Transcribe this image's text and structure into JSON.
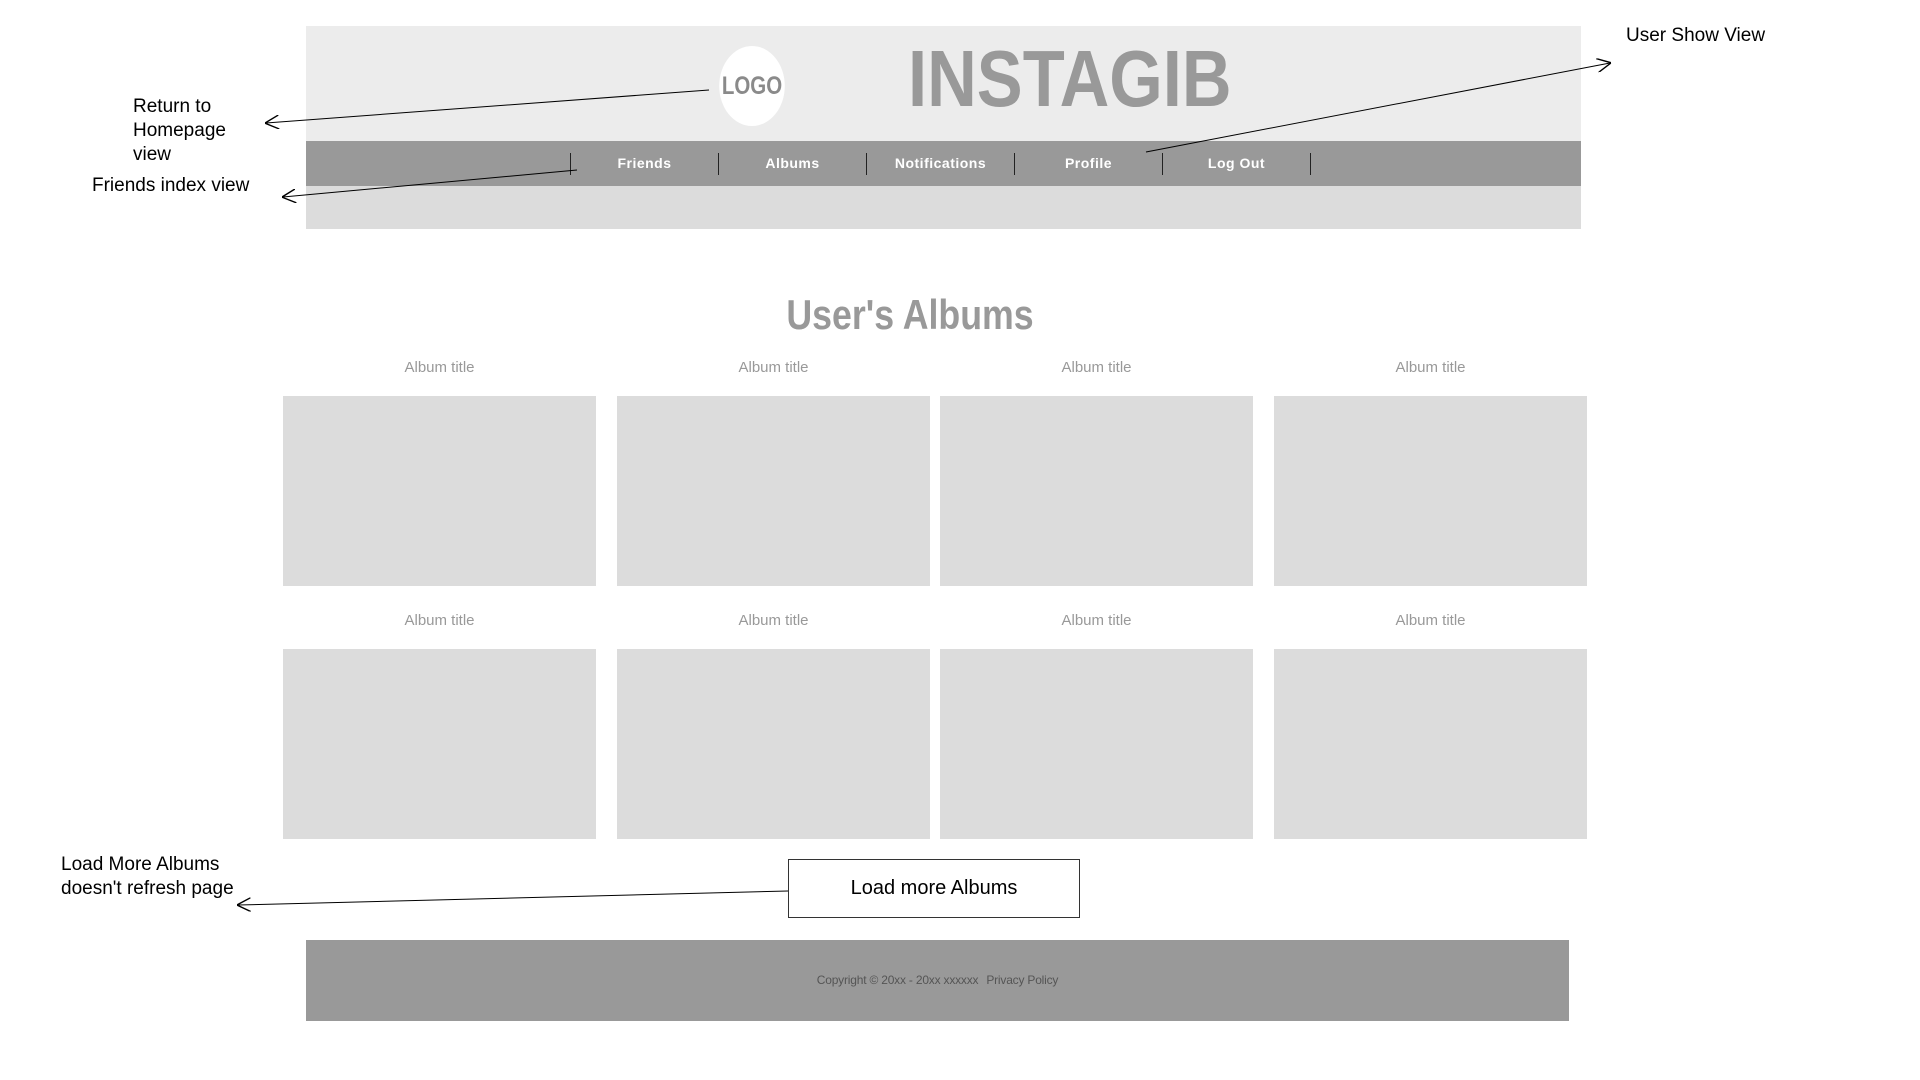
{
  "header": {
    "logo_text": "LOGO",
    "brand_name": "INSTAGIB"
  },
  "nav": {
    "items": [
      {
        "label": "Friends"
      },
      {
        "label": "Albums"
      },
      {
        "label": "Notifications"
      },
      {
        "label": "Profile"
      },
      {
        "label": "Log Out"
      }
    ]
  },
  "main": {
    "title": "User's Albums",
    "albums": [
      {
        "title": "Album title"
      },
      {
        "title": "Album title"
      },
      {
        "title": "Album title"
      },
      {
        "title": "Album title"
      },
      {
        "title": "Album title"
      },
      {
        "title": "Album title"
      },
      {
        "title": "Album title"
      },
      {
        "title": "Album title"
      }
    ],
    "load_more_label": "Load more Albums"
  },
  "footer": {
    "copyright": "Copyright © 20xx - 20xx xxxxxx",
    "privacy_label": "Privacy Policy"
  },
  "annotations": {
    "homepage": "Return to Homepage view",
    "friends": "Friends index view",
    "user_show": "User Show View",
    "load_more": "Load More Albums doesn't refresh page"
  },
  "colors": {
    "header_light": "#ececec",
    "header_band": "#dcdcdc",
    "nav_bar": "#999999",
    "placeholder": "#dcdcdc",
    "title_gray": "#999999"
  }
}
